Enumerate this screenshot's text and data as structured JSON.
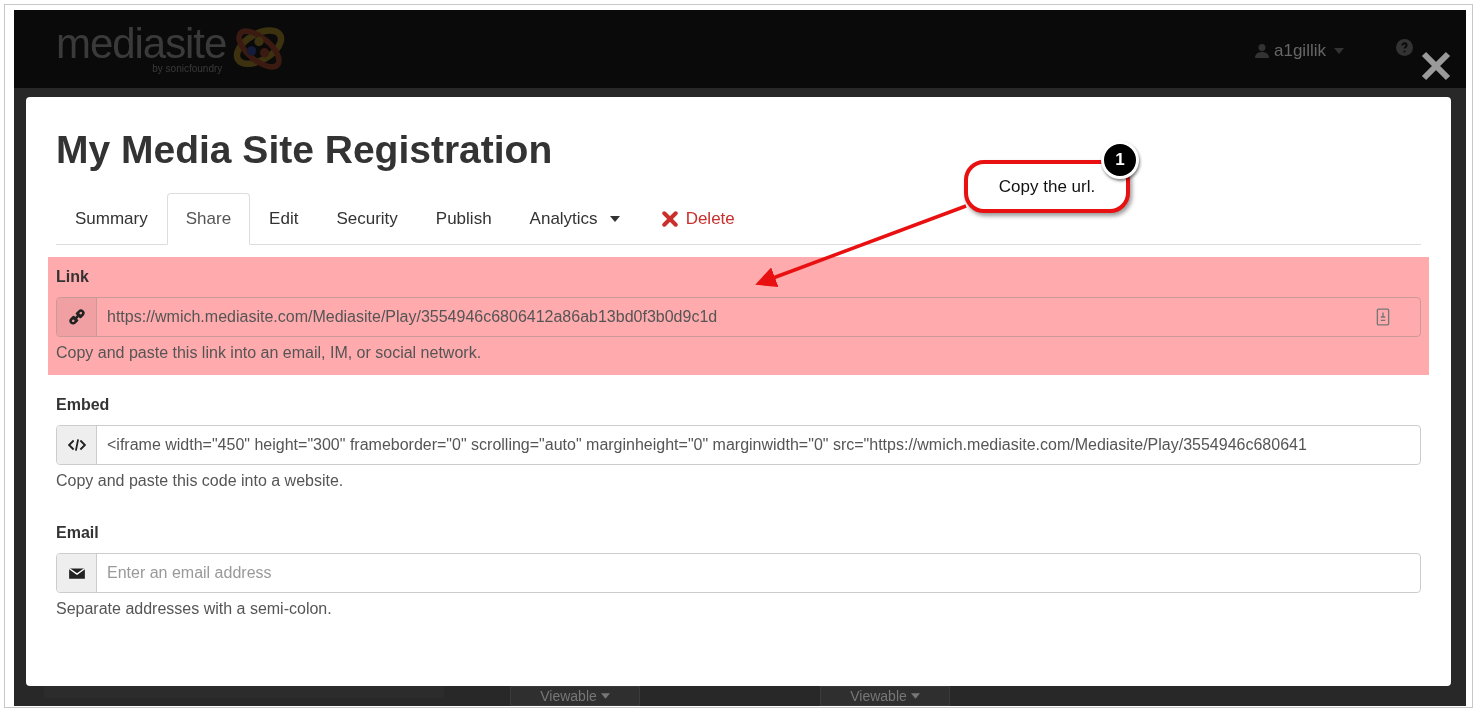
{
  "header": {
    "logo_text": "mediasite",
    "logo_tagline": "by sonicfoundry",
    "user": "a1gillik"
  },
  "modal": {
    "title": "My Media Site Registration",
    "tabs": [
      {
        "label": "Summary",
        "selected": false,
        "kind": "tab"
      },
      {
        "label": "Share",
        "selected": true,
        "kind": "tab"
      },
      {
        "label": "Edit",
        "selected": false,
        "kind": "tab"
      },
      {
        "label": "Security",
        "selected": false,
        "kind": "tab"
      },
      {
        "label": "Publish",
        "selected": false,
        "kind": "tab"
      },
      {
        "label": "Analytics",
        "selected": false,
        "kind": "dropdown"
      },
      {
        "label": "Delete",
        "selected": false,
        "kind": "danger"
      }
    ],
    "sections": [
      {
        "kind": "link",
        "label": "Link",
        "value": "https://wmich.mediasite.com/Mediasite/Play/3554946c6806412a86ab13bd0f3b0d9c1d",
        "help": "Copy and paste this link into an email, IM, or social network.",
        "highlighted": true
      },
      {
        "kind": "embed",
        "label": "Embed",
        "value": "<iframe width=\"450\" height=\"300\" frameborder=\"0\" scrolling=\"auto\" marginheight=\"0\" marginwidth=\"0\" src=\"https://wmich.mediasite.com/Mediasite/Play/3554946c680641",
        "help": "Copy and paste this code into a website.",
        "highlighted": false
      },
      {
        "kind": "email",
        "label": "Email",
        "placeholder": "Enter an email address",
        "help": "Separate addresses with a semi-colon.",
        "highlighted": false
      }
    ]
  },
  "callout": {
    "number": "1",
    "text": "Copy the url."
  },
  "background_buttons": [
    "Viewable",
    "Viewable"
  ]
}
